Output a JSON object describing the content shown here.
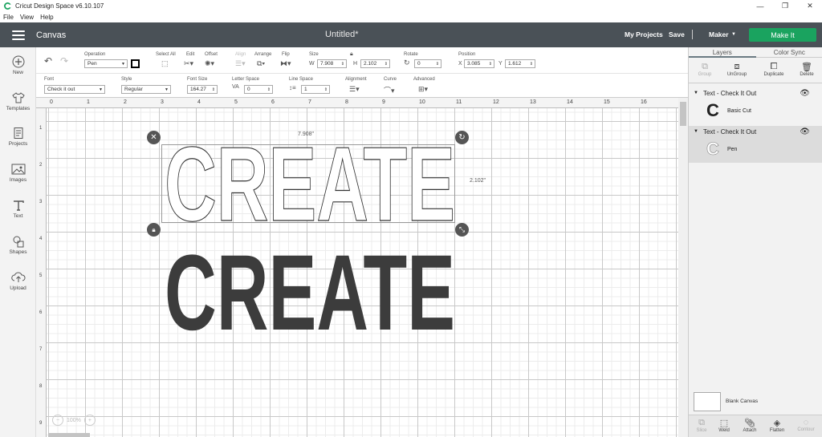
{
  "window": {
    "app_title": "Cricut Design Space  v6.10.107",
    "minimize_glyph": "—",
    "maximize_glyph": "❐",
    "close_glyph": "✕"
  },
  "menu": [
    "File",
    "View",
    "Help"
  ],
  "header": {
    "section": "Canvas",
    "doc_title": "Untitled*",
    "my_projects": "My Projects",
    "save": "Save",
    "divider": "|",
    "machine": "Maker",
    "make_it": "Make It"
  },
  "sidebar": [
    {
      "label": "New",
      "icon": "plus-circle-icon"
    },
    {
      "label": "Templates",
      "icon": "shirt-icon"
    },
    {
      "label": "Projects",
      "icon": "projects-icon"
    },
    {
      "label": "Images",
      "icon": "image-icon"
    },
    {
      "label": "Text",
      "icon": "text-icon"
    },
    {
      "label": "Shapes",
      "icon": "shapes-icon"
    },
    {
      "label": "Upload",
      "icon": "upload-icon"
    }
  ],
  "toolbar1": {
    "operation_label": "Operation",
    "operation_value": "Pen",
    "select_all": "Select All",
    "edit": "Edit",
    "offset": "Offset",
    "align": "Align",
    "arrange": "Arrange",
    "flip": "Flip",
    "size_label": "Size",
    "w_label": "W",
    "w_value": "7.908",
    "h_label": "H",
    "h_value": "2.102",
    "rotate_label": "Rotate",
    "rotate_value": "0",
    "position_label": "Position",
    "x_label": "X",
    "x_value": "3.085",
    "y_label": "Y",
    "y_value": "1.612"
  },
  "toolbar2": {
    "font_label": "Font",
    "font_value": "Check it out",
    "style_label": "Style",
    "style_value": "Regular",
    "font_size_label": "Font Size",
    "font_size_value": "164.27",
    "letter_space_label": "Letter Space",
    "letter_space_value": "0",
    "line_space_label": "Line Space",
    "line_space_value": "1",
    "alignment_label": "Alignment",
    "curve_label": "Curve",
    "advanced_label": "Advanced"
  },
  "ruler": {
    "top": [
      "0",
      "1",
      "2",
      "3",
      "4",
      "5",
      "6",
      "7",
      "8",
      "9",
      "10",
      "11",
      "12",
      "13",
      "14",
      "15",
      "16"
    ],
    "left": [
      "1",
      "2",
      "3",
      "4",
      "5",
      "6",
      "7",
      "8",
      "9"
    ]
  },
  "canvas": {
    "width_dim": "7.908\"",
    "height_dim": "2.102\"",
    "outline_text": "CREATE",
    "filled_text": "CREATE",
    "zoom": "100%"
  },
  "panel": {
    "tabs": [
      "Layers",
      "Color Sync"
    ],
    "actions": [
      {
        "label": "Group",
        "enabled": false
      },
      {
        "label": "UnGroup",
        "enabled": true
      },
      {
        "label": "Duplicate",
        "enabled": true
      },
      {
        "label": "Delete",
        "enabled": true
      }
    ],
    "layers": [
      {
        "name": "Text - Check It Out",
        "op": "Basic Cut",
        "thumb": "C"
      },
      {
        "name": "Text - Check It Out",
        "op": "Pen",
        "thumb": "C"
      }
    ],
    "blank_canvas": "Blank Canvas",
    "bottom_actions": [
      {
        "label": "Slice",
        "enabled": false
      },
      {
        "label": "Weld",
        "enabled": true
      },
      {
        "label": "Attach",
        "enabled": true
      },
      {
        "label": "Flatten",
        "enabled": true
      },
      {
        "label": "Contour",
        "enabled": false
      }
    ]
  },
  "colors": {
    "header": "#4a5157",
    "make_it": "#1aa35f",
    "filled_text": "#3c3c3c"
  }
}
